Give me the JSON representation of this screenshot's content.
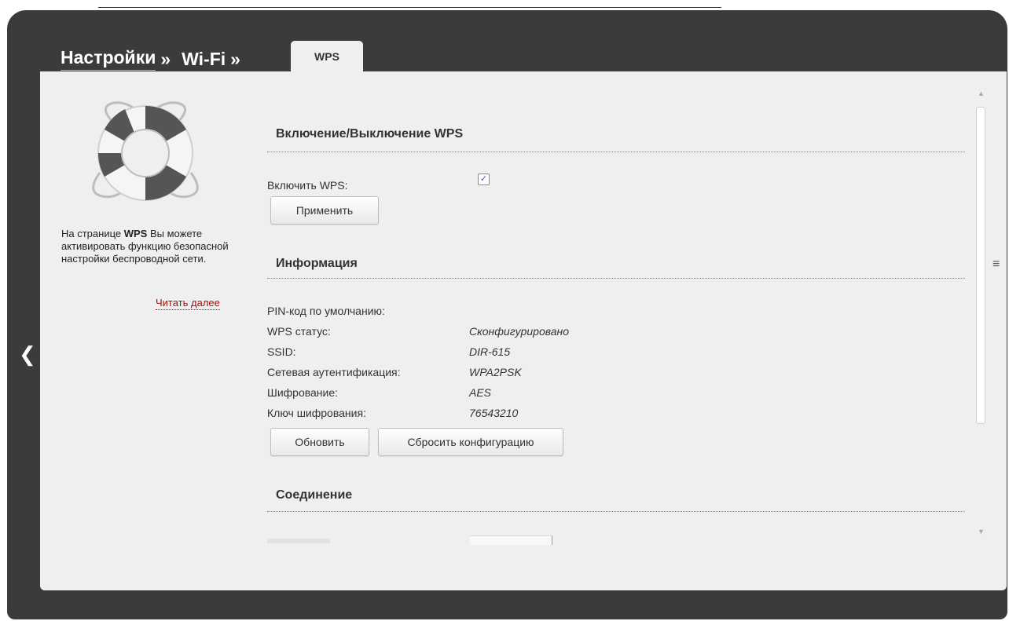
{
  "breadcrumb": {
    "items": [
      "Настройки",
      "Wi-Fi"
    ],
    "separator": "»",
    "active_tab": "WPS"
  },
  "sidebar": {
    "description_prefix": "На странице ",
    "description_bold": "WPS",
    "description_suffix": " Вы можете активировать функцию безопасной настройки беспроводной сети.",
    "read_more": "Читать далее",
    "icon": "lifebuoy-icon"
  },
  "sections": {
    "toggle": {
      "title": "Включение/Выключение WPS",
      "enable_label": "Включить WPS:",
      "enabled": true,
      "apply_button": "Применить"
    },
    "info": {
      "title": "Информация",
      "rows": [
        {
          "label": "PIN-код по умолчанию:",
          "value": ""
        },
        {
          "label": "WPS статус:",
          "value": "Сконфигурировано"
        },
        {
          "label": "SSID:",
          "value": "DIR-615"
        },
        {
          "label": "Сетевая аутентификация:",
          "value": "WPA2PSK"
        },
        {
          "label": "Шифрование:",
          "value": "AES"
        },
        {
          "label": "Ключ шифрования:",
          "value": "76543210"
        }
      ],
      "refresh_button": "Обновить",
      "reset_button": "Сбросить конфигурацию"
    },
    "connection": {
      "title": "Соединение"
    }
  },
  "colors": {
    "frame": "#3b3b3b",
    "panel": "#efefef",
    "link": "#a01010"
  }
}
